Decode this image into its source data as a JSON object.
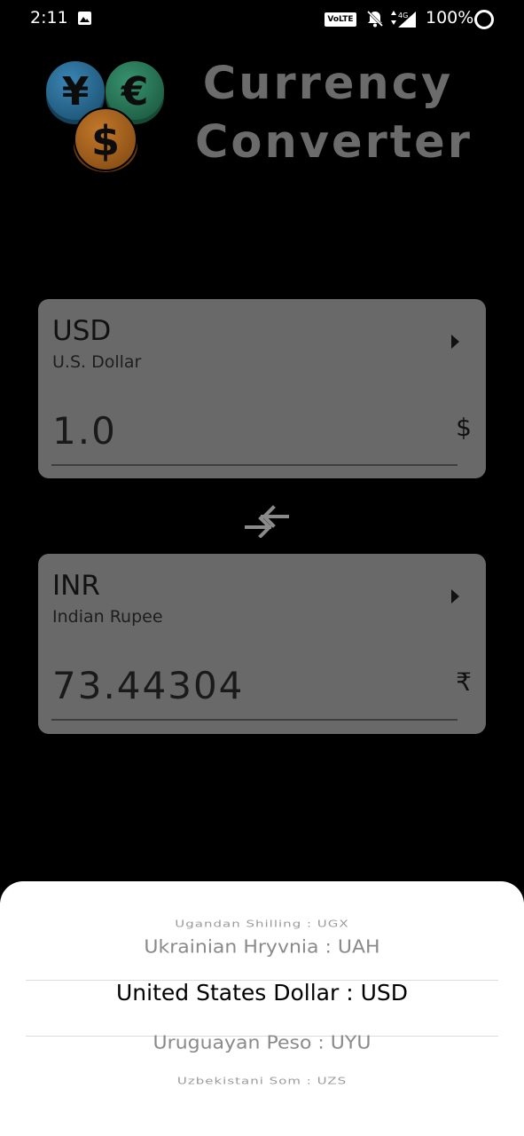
{
  "status_bar": {
    "time": "2:11",
    "volte": "VoLTE",
    "network": "4G",
    "battery": "100%"
  },
  "app": {
    "title_line1": "Currency",
    "title_line2": "Converter",
    "logo_symbols": [
      "¥",
      "€",
      "$"
    ],
    "logo_colors": [
      "#2f6f96",
      "#2c7a5e",
      "#a8651f"
    ]
  },
  "from_card": {
    "code": "USD",
    "name": "U.S. Dollar",
    "amount": "1.0",
    "symbol": "$"
  },
  "to_card": {
    "code": "INR",
    "name": "Indian Rupee",
    "amount": "73.44304",
    "symbol": "₹"
  },
  "picker": {
    "items": [
      "Ugandan Shilling : UGX",
      "Ukrainian Hryvnia : UAH",
      "United States Dollar : USD",
      "Uruguayan Peso : UYU",
      "Uzbekistani Som : UZS"
    ],
    "selected": "United States Dollar : USD"
  },
  "colors": {
    "card_bg": "#696969",
    "title_color": "#6b6b6b",
    "background": "#000000",
    "sheet_bg": "#ffffff"
  }
}
